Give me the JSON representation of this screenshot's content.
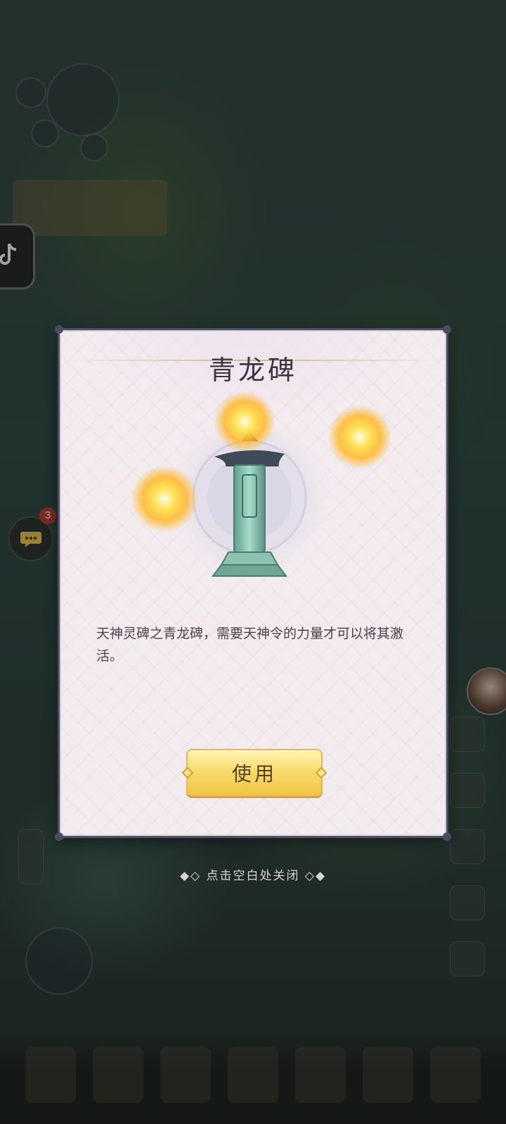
{
  "dialog": {
    "title": "青龙碑",
    "description": "天神灵碑之青龙碑，需要天神令的力量才可以将其激活。",
    "use_button_label": "使用",
    "item_icon": "qinglong-stele-icon"
  },
  "close_hint": "◆◇ 点击空白处关闭 ◇◆",
  "background": {
    "chat_badge_count": "3"
  },
  "colors": {
    "dialog_bg": "#f3ecef",
    "dialog_border": "#4b4e62",
    "button_gold": "#f8dc6c",
    "title_text": "#3c3440"
  }
}
